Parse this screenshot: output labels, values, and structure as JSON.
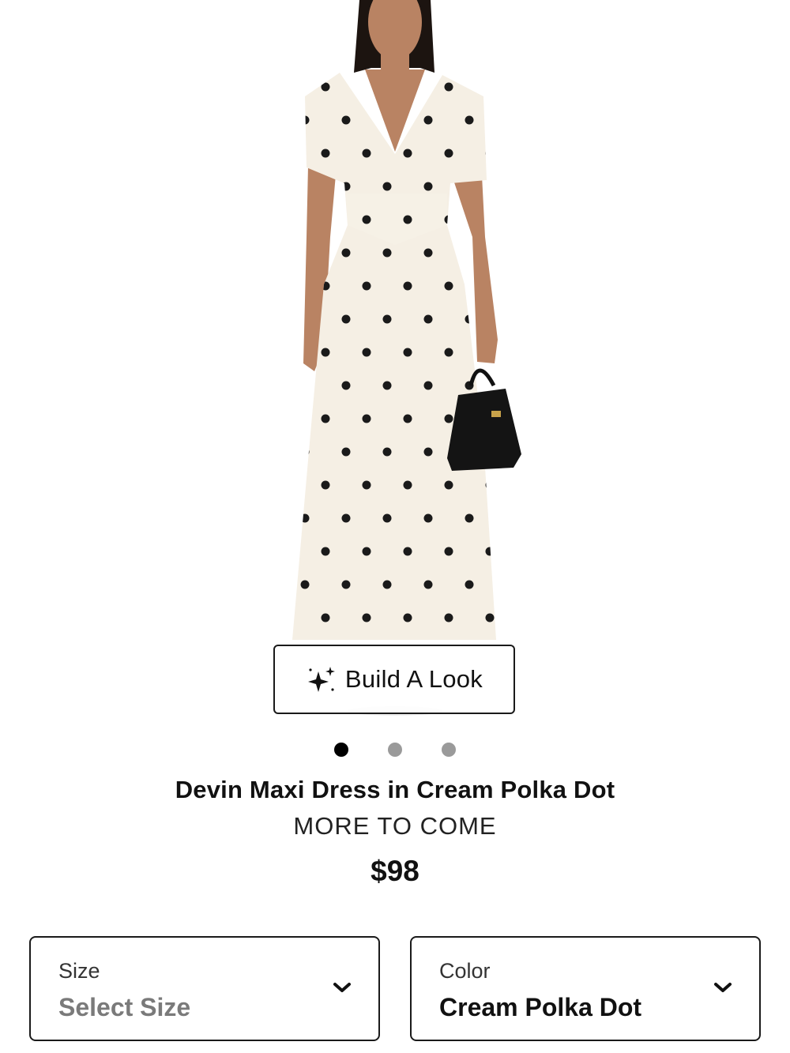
{
  "product": {
    "name": "Devin Maxi Dress in Cream Polka Dot",
    "brand": "MORE TO COME",
    "price": "$98"
  },
  "build_look": {
    "label": "Build A Look",
    "icon": "sparkle-icon"
  },
  "carousel": {
    "slides": 3,
    "active_index": 0
  },
  "size_selector": {
    "label": "Size",
    "value": "Select Size",
    "icon": "chevron-down-icon"
  },
  "color_selector": {
    "label": "Color",
    "value": "Cream Polka Dot",
    "icon": "chevron-down-icon"
  },
  "colors": {
    "dress": "#f5efe4",
    "dots": "#1a1a1a",
    "skin": "#b98363",
    "hair": "#1c1410",
    "inactive_dot": "#9a9a9a"
  }
}
